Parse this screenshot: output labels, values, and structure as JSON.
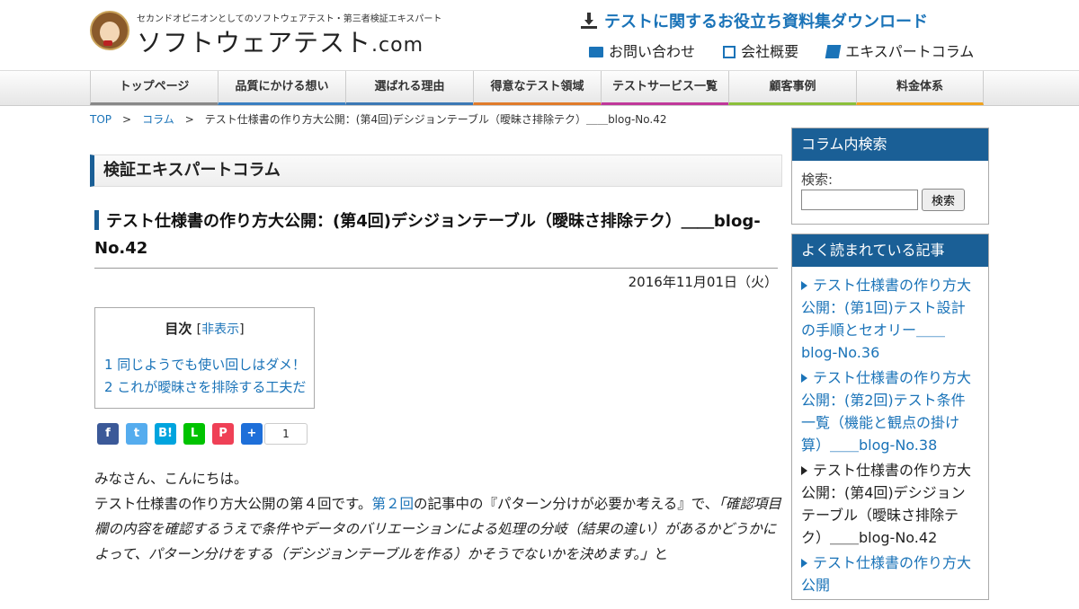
{
  "header": {
    "tagline": "セカンドオピニオンとしてのソフトウェアテスト・第三者検証エキスパート",
    "logo_text": "ソフトウェアテスト",
    "logo_domain": ".com",
    "download_label": "テストに関するお役立ち資料集ダウンロード",
    "links": [
      "お問い合わせ",
      "会社概要",
      "エキスパートコラム"
    ]
  },
  "nav": {
    "items": [
      {
        "label": "トップページ",
        "color": "#888888"
      },
      {
        "label": "品質にかける想い",
        "color": "#3a7fc1"
      },
      {
        "label": "選ばれる理由",
        "color": "#3c79b5"
      },
      {
        "label": "得意なテスト領域",
        "color": "#e07b2a"
      },
      {
        "label": "テストサービス一覧",
        "color": "#c0389a"
      },
      {
        "label": "顧客事例",
        "color": "#8bbf3a"
      },
      {
        "label": "料金体系",
        "color": "#f0a21e"
      }
    ]
  },
  "breadcrumb": {
    "top": "TOP",
    "sep": ">",
    "column": "コラム",
    "current": "テスト仕様書の作り方大公開：(第4回)デシジョンテーブル（曖昧さ排除テク）＿＿blog-No.42"
  },
  "main": {
    "section_title": "検証エキスパートコラム",
    "article_title": "テスト仕様書の作り方大公開：(第4回)デシジョンテーブル（曖昧さ排除テク）＿＿blog-No.42",
    "date": "2016年11月01日（火）",
    "toc": {
      "title": "目次",
      "toggle_open": "[",
      "toggle": "非表示",
      "toggle_close": "]",
      "items": [
        "1 同じようでも使い回しはダメ！",
        "2 これが曖昧さを排除する工夫だ"
      ]
    },
    "share": {
      "buttons": [
        {
          "icon": "facebook-icon",
          "glyph": "f",
          "color": "#3b5998"
        },
        {
          "icon": "twitter-icon",
          "glyph": "t",
          "color": "#55acee"
        },
        {
          "icon": "hatena-bookmark-icon",
          "glyph": "B!",
          "color": "#00a4de"
        },
        {
          "icon": "line-icon",
          "glyph": "L",
          "color": "#00c300"
        },
        {
          "icon": "pocket-icon",
          "glyph": "P",
          "color": "#ef4056"
        },
        {
          "icon": "share-icon",
          "glyph": "+",
          "color": "#1e6fd9"
        }
      ],
      "count": "1"
    },
    "body": {
      "greeting": "みなさん、こんにちは。",
      "p1_a": "テスト仕様書の作り方大公開の第４回です。",
      "p1_link": "第２回",
      "p1_b": "の記事中の『パターン分けが必要か考える』で、",
      "p1_quote": "「確認項目欄の内容を確認するうえで条件やデータのバリエーションによる処理の分岐（結果の違い）があるかどうかによって、パターン分けをする（デシジョンテーブルを作る）かそうでないかを決めます。」",
      "p1_c": "と"
    }
  },
  "sidebar": {
    "search": {
      "title": "コラム内検索",
      "label": "検索:",
      "button": "検索",
      "value": ""
    },
    "popular": {
      "title": "よく読まれている記事",
      "items": [
        "テスト仕様書の作り方大公開：(第1回)テスト設計の手順とセオリー＿＿blog-No.36",
        "テスト仕様書の作り方大公開：(第2回)テスト条件一覧（機能と観点の掛け算）＿＿blog-No.38",
        "テスト仕様書の作り方大公開：(第4回)デシジョンテーブル（曖昧さ排除テク）＿＿blog-No.42",
        "テスト仕様書の作り方大公開"
      ]
    }
  }
}
